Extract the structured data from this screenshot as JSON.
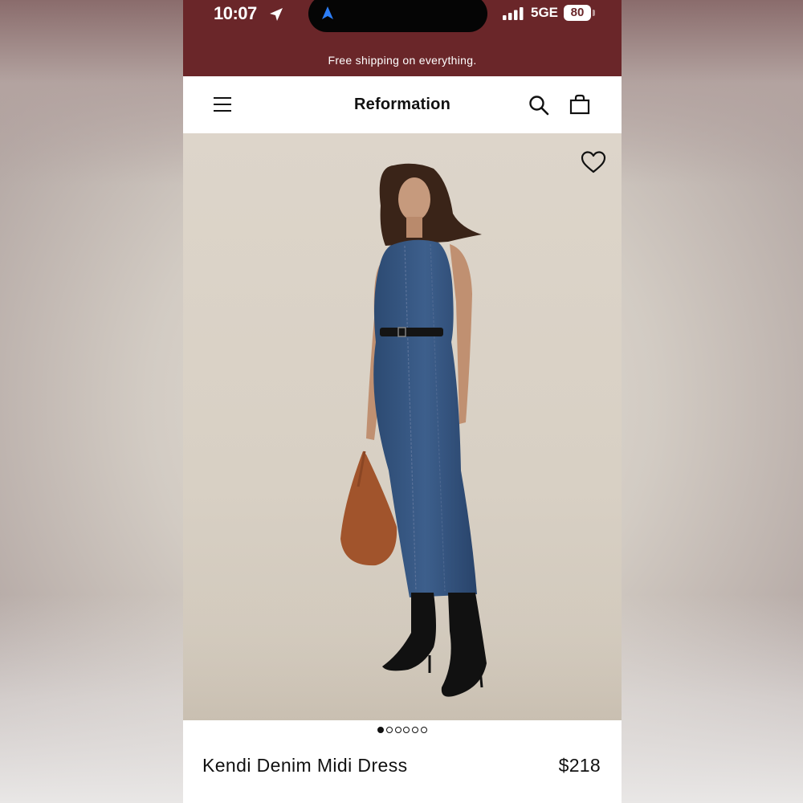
{
  "status_bar": {
    "time": "10:07",
    "network": "5GE",
    "battery": "80"
  },
  "promo": {
    "text": "Free shipping on everything."
  },
  "header": {
    "brand": "Reformation",
    "icons": [
      "menu-icon",
      "search-icon",
      "bag-icon"
    ]
  },
  "product": {
    "name": "Kendi Denim Midi Dress",
    "price": "$218",
    "image_count": 6,
    "active_image": 1,
    "wishlist_icon": "heart-icon"
  },
  "colors": {
    "status_bar": "#6a2629",
    "header_bg": "#ffffff",
    "hero_bg": "#ddd5ca",
    "text": "#111111"
  }
}
